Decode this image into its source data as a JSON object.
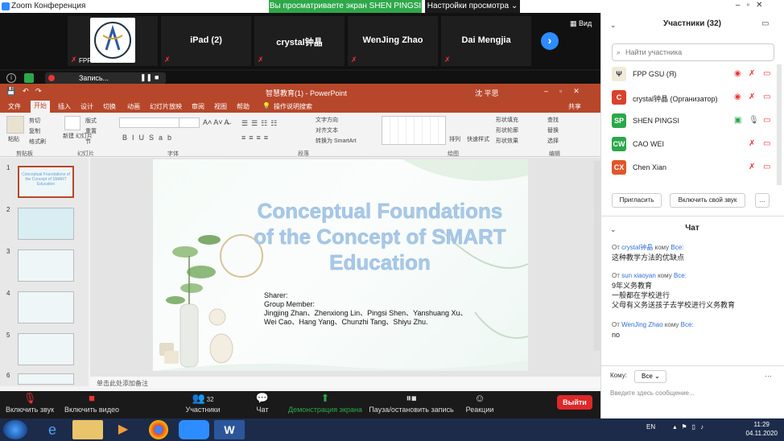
{
  "zoom": {
    "title": "Zoom Конференция",
    "share_banner": "Вы просматриваете экран SHEN PINGSI",
    "view_settings": "Настройки просмотра ⌄",
    "view_button": "Вид",
    "recording_label": "Запись..."
  },
  "video_tiles": [
    {
      "name": "FPP GSU",
      "is_logo": true
    },
    {
      "name": "iPad (2)"
    },
    {
      "name": "crystal钟晶"
    },
    {
      "name": "WenJing Zhao"
    },
    {
      "name": "Dai  Mengjia"
    }
  ],
  "ppt": {
    "title": "智慧教育(1) - PowerPoint",
    "user": "沈 平思",
    "share": "共享",
    "tabs": [
      "文件",
      "开始",
      "插入",
      "设计",
      "切换",
      "动画",
      "幻灯片放映",
      "审阅",
      "视图",
      "帮助",
      "操作说明搜索"
    ],
    "ribbon_groups": [
      "剪贴板",
      "幻灯片",
      "字体",
      "段落",
      "绘图",
      "编辑"
    ],
    "ribbon_items": {
      "paste": "粘贴",
      "cut": "剪切",
      "copy": "复制",
      "format_painter": "格式刷",
      "new_slide": "新建\n幻灯片",
      "layout": "版式",
      "reset": "重置",
      "section": "节",
      "text_direction": "文字方向",
      "align_text": "对齐文本",
      "smartart": "转换为 SmartArt",
      "arrange": "排列",
      "quick_styles": "快速样式",
      "shape_fill": "形状填充",
      "shape_outline": "形状轮廓",
      "shape_effects": "形状效果",
      "find": "查找",
      "replace": "替换",
      "select": "选择"
    },
    "slide_numbers": [
      "1",
      "2",
      "3",
      "4",
      "5",
      "6"
    ],
    "thumb1_text": "Conceptual Foundations of the Concept of SMART Education",
    "slide": {
      "title_lines": [
        "Conceptual Foundations",
        "of the Concept of SMART",
        "Education"
      ],
      "body_lines": [
        "Sharer:",
        "Group Member:",
        "Jingjing Zhan、Zhenxiong Lin、Pingsi Shen、Yanshuang Xu、",
        "Wei Cao、Hang Yang、Chunzhi Tang、Shiyu Zhu."
      ]
    },
    "notes_placeholder": "单击此处添加备注"
  },
  "toolbar": {
    "mute": "Включить звук",
    "video": "Включить видео",
    "participants": "Участники",
    "participants_count": "32",
    "chat": "Чат",
    "share": "Демонстрация экрана",
    "record": "Пауза/остановить запись",
    "reactions": "Реакции",
    "leave": "Выйти"
  },
  "participants_panel": {
    "title": "Участники (32)",
    "search_placeholder": "Найти участника",
    "participants": [
      {
        "name": "FPP GSU (Я)",
        "initials": "",
        "color": "#e8e0d0"
      },
      {
        "name": "crystal钟晶 (Организатор)",
        "initials": "C",
        "color": "#d9422c"
      },
      {
        "name": "SHEN PINGSI",
        "initials": "SP",
        "color": "#2aa84a"
      },
      {
        "name": "CAO WEI",
        "initials": "CW",
        "color": "#2aa84a"
      },
      {
        "name": "Chen Xian",
        "initials": "CX",
        "color": "#e0562a"
      }
    ],
    "invite_button": "Пригласить",
    "unmute_button": "Включить свой звук",
    "more_button": "..."
  },
  "chat": {
    "title": "Чат",
    "messages": [
      {
        "from_prefix": "От",
        "from": "crystal钟晶",
        "to_prefix": "кому",
        "to": "Все:",
        "lines": [
          "这种教学方法的优缺点"
        ]
      },
      {
        "from_prefix": "От",
        "from": "sun xiaoyan",
        "to_prefix": "кому",
        "to": "Все:",
        "lines": [
          "9年义务教育",
          "一般都在学校进行",
          "父母有义务送孩子去学校进行义务教育"
        ]
      },
      {
        "from_prefix": "От",
        "from": "WenJing Zhao",
        "to_prefix": "кому",
        "to": "Все:",
        "lines": [
          "no"
        ]
      }
    ],
    "to_label": "Кому:",
    "to_value": "Все",
    "input_placeholder": "Введите здесь сообщение..."
  },
  "taskbar": {
    "lang": "EN",
    "time": "11:29",
    "date": "04.11.2020"
  }
}
